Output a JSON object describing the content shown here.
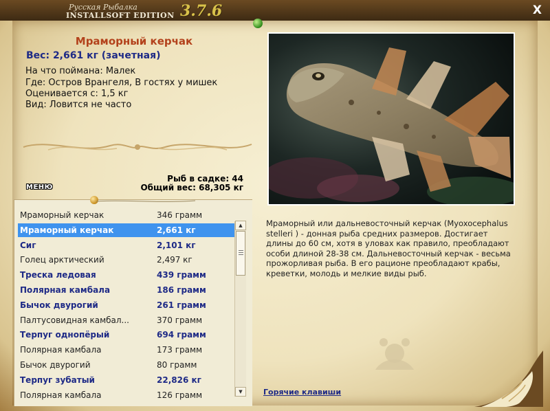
{
  "app": {
    "logo_title": "Русская Рыбалка",
    "logo_edition": "INSTALLSOFT EDITION",
    "logo_version": "3.7.6",
    "close_label": "X"
  },
  "fish": {
    "title": "Мраморный керчак",
    "weight_line": "Вес: 2,661 кг (зачетная)",
    "bait": "На что поймана: Малек",
    "place": "Где: Остров Врангеля, В гостях у мишек",
    "valued_from": "Оценивается с: 1,5 кг",
    "kind": "Вид: Ловится не часто"
  },
  "keepnet": {
    "count": "Рыб в садке: 44",
    "total_weight": "Общий вес: 68,305 кг"
  },
  "menu_label": "МЕНЮ",
  "catch_list": [
    {
      "name": "Мраморный керчак",
      "weight": "346 грамм",
      "style": "normal"
    },
    {
      "name": "Мраморный керчак",
      "weight": "2,661 кг",
      "style": "selected"
    },
    {
      "name": "Сиг",
      "weight": "2,101 кг",
      "style": "bold"
    },
    {
      "name": "Голец арктический",
      "weight": "2,497 кг",
      "style": "normal"
    },
    {
      "name": "Треска ледовая",
      "weight": "439 грамм",
      "style": "bold"
    },
    {
      "name": "Полярная камбала",
      "weight": "186 грамм",
      "style": "bold"
    },
    {
      "name": "Бычок двурогий",
      "weight": "261 грамм",
      "style": "bold"
    },
    {
      "name": "Палтусовидная камбал...",
      "weight": "370 грамм",
      "style": "normal"
    },
    {
      "name": "Терпуг однопёрый",
      "weight": "694 грамм",
      "style": "bold"
    },
    {
      "name": "Полярная камбала",
      "weight": "173 грамм",
      "style": "normal"
    },
    {
      "name": "Бычок двурогий",
      "weight": "80 грамм",
      "style": "normal"
    },
    {
      "name": "Терпуг зубатый",
      "weight": "22,826 кг",
      "style": "bold"
    },
    {
      "name": "Полярная камбала",
      "weight": "126 грамм",
      "style": "normal"
    }
  ],
  "description": "Мраморный или дальневосточный керчак (Myoxocephalus stelleri ) - донная рыба средних размеров. Достигает длины до 60 см, хотя в уловах как правило, преобладают особи длиной 28-38 см. Дальневосточный керчак - весьма прожорливая рыба. В его рационе преобладают крабы, креветки, молодь и мелкие виды рыб.",
  "hotkeys_label": "Горячие клавиши",
  "colors": {
    "title_red": "#b3421c",
    "highlight_blue": "#1e2a86",
    "selection": "#3f93ee"
  }
}
